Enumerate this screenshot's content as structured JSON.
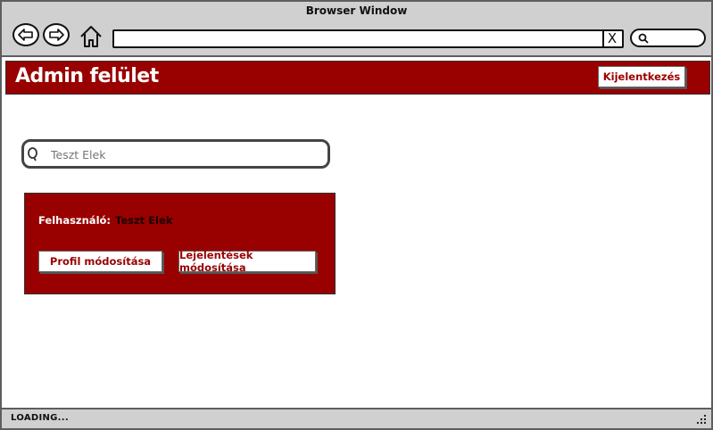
{
  "browser": {
    "title": "Browser Window",
    "url": "",
    "clear_glyph": "X",
    "status": "LOADING..."
  },
  "header": {
    "title": "Admin felület",
    "logout_label": "Kijelentkezés"
  },
  "search": {
    "placeholder": "Teszt Elek"
  },
  "user_card": {
    "user_label": "Felhasználó:",
    "user_value": "Teszt Elek",
    "edit_profile_label": "Profil módosítása",
    "edit_reports_label": "Lejelentések módosítása"
  },
  "colors": {
    "brand": "#990000",
    "chrome": "#d0d0d0",
    "background": "#ffffff"
  },
  "icons": {
    "back": "back-arrow-icon",
    "forward": "forward-arrow-icon",
    "home": "home-icon",
    "search": "search-icon",
    "clear": "close-icon",
    "resize": "resize-grip-icon"
  }
}
